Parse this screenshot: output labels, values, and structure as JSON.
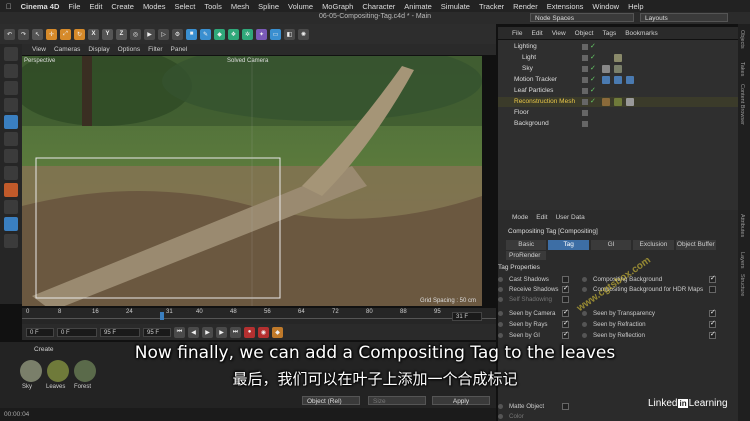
{
  "menubar": {
    "apple": "",
    "app": "Cinema 4D",
    "items": [
      "File",
      "Edit",
      "Create",
      "Modes",
      "Select",
      "Tools",
      "Mesh",
      "Spline",
      "Volume",
      "MoGraph",
      "Character",
      "Animate",
      "Simulate",
      "Tracker",
      "Render",
      "Extensions",
      "Window",
      "Help"
    ]
  },
  "window": {
    "title": "06-05-Compositing-Tag.c4d * - Main",
    "node_spaces": "Node Spaces",
    "layouts": "Layouts"
  },
  "toolbar": {
    "icons": [
      "undo",
      "move",
      "scale",
      "rotate",
      "x-axis",
      "y-axis",
      "z-axis",
      "world",
      "render-view",
      "render",
      "render-settings",
      "cube",
      "pen",
      "subdivision",
      "cloner",
      "field",
      "deformer",
      "floor",
      "camera",
      "light",
      "tag"
    ],
    "axis_labels": [
      "X",
      "Y",
      "Z"
    ]
  },
  "viewport": {
    "menu": [
      "View",
      "Cameras",
      "Display",
      "Options",
      "Filter",
      "Panel"
    ],
    "label_perspective": "Perspective",
    "label_camera": "Solved Camera",
    "grid_spacing": "Grid Spacing : 50 cm"
  },
  "timeline": {
    "ticks": [
      "0",
      "8",
      "16",
      "24",
      "31",
      "40",
      "48",
      "56",
      "64",
      "72",
      "80",
      "88",
      "95"
    ],
    "current_frame_field": "31 F"
  },
  "transport": {
    "start": "0 F",
    "start2": "0 F",
    "end": "95 F",
    "end2": "95 F"
  },
  "materials": {
    "menu": [
      "Create"
    ],
    "items": [
      {
        "name": "Sky",
        "color": "#7a7f6a"
      },
      {
        "name": "Leaves",
        "color": "#6f7a3a"
      },
      {
        "name": "Forest",
        "color": "#5a6a4a"
      }
    ],
    "coord_select": "Object (Rel)",
    "size_select": "Size",
    "apply_label": "Apply"
  },
  "status": {
    "time": "00:00:04"
  },
  "object_manager": {
    "menu": [
      "File",
      "Edit",
      "View",
      "Object",
      "Tags",
      "Bookmarks"
    ],
    "objects": [
      {
        "name": "Lighting",
        "indent": 0,
        "color": "#ddd"
      },
      {
        "name": "Light",
        "indent": 1,
        "color": "#ddd"
      },
      {
        "name": "Sky",
        "indent": 1,
        "color": "#ddd"
      },
      {
        "name": "Motion Tracker",
        "indent": 0,
        "color": "#ddd"
      },
      {
        "name": "Leaf Particles",
        "indent": 0,
        "color": "#ddd"
      },
      {
        "name": "Reconstruction Mesh",
        "indent": 0,
        "color": "#e8c648",
        "selected": true
      },
      {
        "name": "Floor",
        "indent": 0,
        "color": "#ddd"
      },
      {
        "name": "Background",
        "indent": 0,
        "color": "#ddd"
      }
    ]
  },
  "attributes": {
    "menu": [
      "Mode",
      "Edit",
      "User Data"
    ],
    "title": "Compositing Tag [Compositing]",
    "tabs": [
      "Basic",
      "Tag",
      "GI",
      "Exclusion",
      "Object Buffer"
    ],
    "active_tab": "Tag",
    "subtab": "ProRender",
    "section": "Tag Properties",
    "left_props": [
      {
        "label": "Cast Shadows",
        "checked": false
      },
      {
        "label": "Receive Shadows",
        "checked": true
      },
      {
        "label": "Self Shadowing",
        "checked": false,
        "dim": true
      },
      {
        "label": "Seen by Camera",
        "checked": true
      },
      {
        "label": "Seen by Rays",
        "checked": true
      },
      {
        "label": "Seen by GI",
        "checked": true
      },
      {
        "label": "Matte Object",
        "checked": false
      },
      {
        "label": "Color",
        "checked": false,
        "dim": true
      }
    ],
    "right_props": [
      {
        "label": "Compositing Background",
        "checked": true
      },
      {
        "label": "Compositing Background for HDR Maps",
        "checked": false
      },
      {
        "label": "Seen by Transparency",
        "checked": true
      },
      {
        "label": "Seen by Refraction",
        "checked": true
      },
      {
        "label": "Seen by Reflection",
        "checked": true
      }
    ]
  },
  "side_tabs": [
    "Objects",
    "Takes",
    "Content Browser",
    "Attributes",
    "Layers",
    "Structure"
  ],
  "subtitles": {
    "en": "Now finally, we can add a Compositing Tag to the leaves",
    "cn": "最后，我们可以在叶子上添加一个合成标记"
  },
  "watermark": {
    "left": "Linked",
    "in": "in",
    "right": "Learning",
    "overlay": "www.cgtsbox.com"
  }
}
